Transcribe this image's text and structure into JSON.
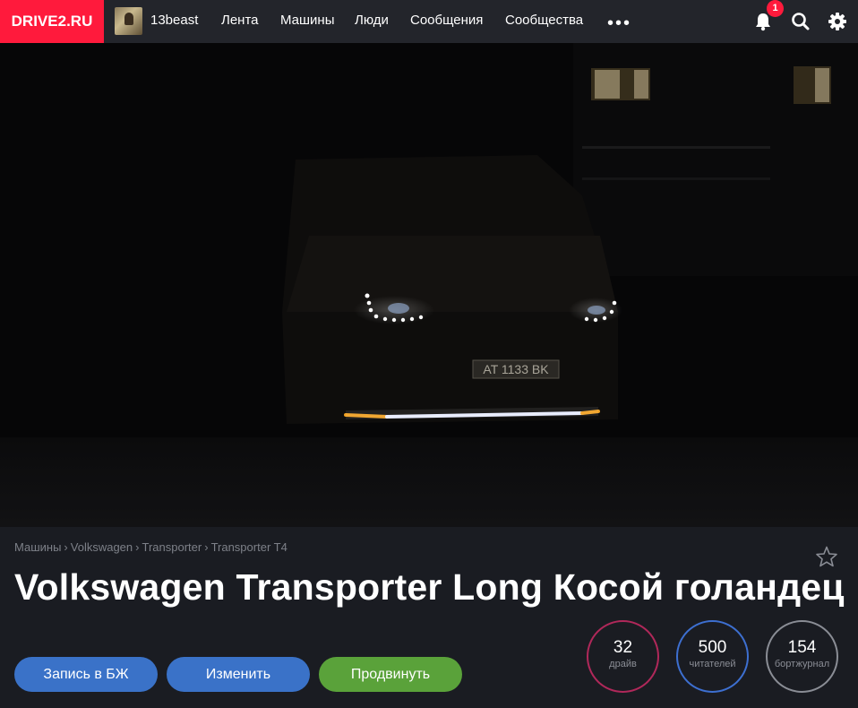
{
  "header": {
    "logo": "DRIVE2.RU",
    "username": "13beast",
    "nav": [
      "Лента",
      "Машины",
      "Люди",
      "Сообщения",
      "Сообщества"
    ],
    "more": "•••",
    "notifications_count": "1",
    "icons": {
      "notifications": "bell-icon",
      "search": "search-icon",
      "settings": "gear-icon"
    }
  },
  "hero": {
    "plate_text": "AT 1133 BK"
  },
  "breadcrumb": [
    "Машины",
    "Volkswagen",
    "Transporter",
    "Transporter T4"
  ],
  "breadcrumb_separator": "›",
  "title": "Volkswagen Transporter Long Косой голандец",
  "buttons": {
    "blog_post": "Запись в БЖ",
    "edit": "Изменить",
    "promote": "Продвинуть"
  },
  "stats": [
    {
      "value": "32",
      "label": "драйв",
      "color": "#b0285a"
    },
    {
      "value": "500",
      "label": "читателей",
      "color": "#3d6fd0"
    },
    {
      "value": "154",
      "label": "бортжурнал",
      "color": "#8a8d95"
    }
  ],
  "colors": {
    "brand": "#ff1a3c",
    "topbar": "#23252b",
    "background": "#1a1c22",
    "button_blue": "#3a72c8",
    "button_green": "#5aa23a"
  }
}
